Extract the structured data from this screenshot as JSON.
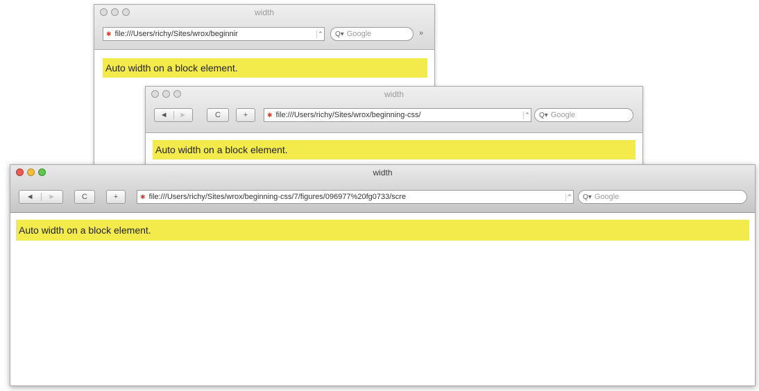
{
  "windows": [
    {
      "title": "width",
      "url": "file:///Users/richy/Sites/wrox/beginnir",
      "search_placeholder": "Google",
      "overflow_symbol": "»",
      "content_text": "Auto width on a block element."
    },
    {
      "title": "width",
      "back": "◄",
      "forward": "►",
      "reload": "C",
      "add": "+",
      "url": "file:///Users/richy/Sites/wrox/beginning-css/",
      "search_placeholder": "Google",
      "content_text": "Auto width on a block element."
    },
    {
      "title": "width",
      "back": "◄",
      "forward": "►",
      "reload": "C",
      "add": "+",
      "url": "file:///Users/richy/Sites/wrox/beginning-css/7/figures/096977%20fg0733/scre",
      "search_placeholder": "Google",
      "content_text": "Auto width on a block element."
    }
  ],
  "colors": {
    "highlight": "#f3ea4b",
    "close": "#ee5a52",
    "minimize": "#f4bd3e",
    "maximize": "#5fc74d"
  },
  "icons": {
    "favicon": "page-favicon-icon",
    "search": "magnifier-icon",
    "dropdown": "chevron-down-icon",
    "reload": "reload-icon",
    "add": "plus-icon"
  }
}
